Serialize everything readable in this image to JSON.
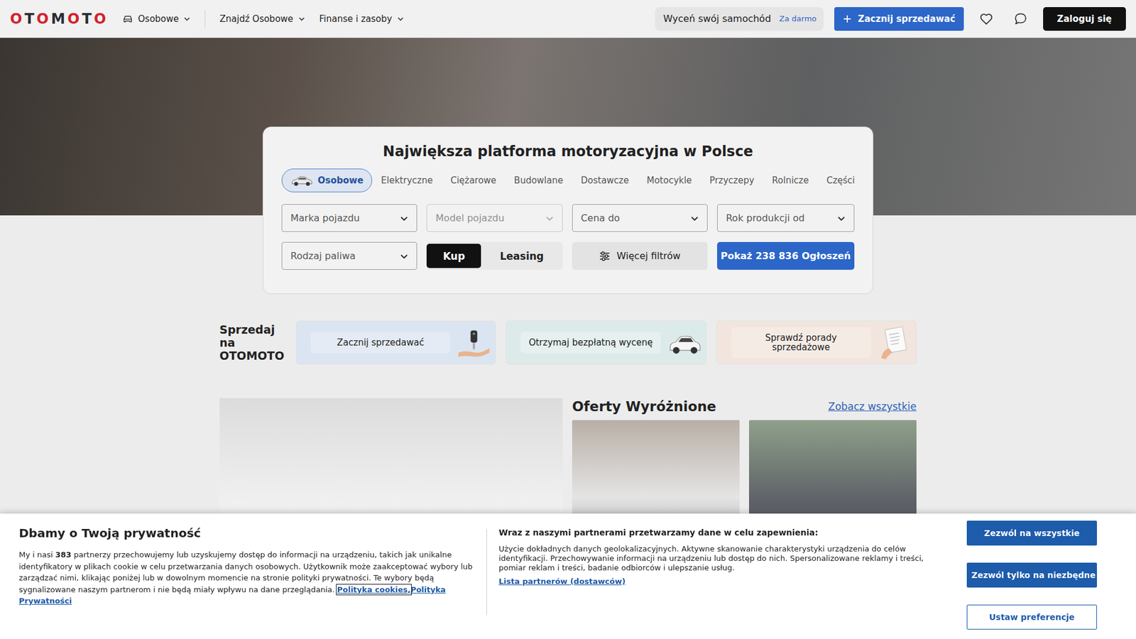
{
  "header": {
    "logo": "OTOMOTO",
    "nav": [
      {
        "label": "Osobowe"
      },
      {
        "label": "Znajdź Osobowe"
      },
      {
        "label": "Finanse i zasoby"
      }
    ],
    "valuation": {
      "label": "Wyceń swój samochód",
      "badge": "Za darmo"
    },
    "sell_button": "Zacznij sprzedawać",
    "login_button": "Zaloguj się"
  },
  "search": {
    "title": "Największa platforma motoryzacyjna w Polsce",
    "tabs": [
      {
        "label": "Osobowe",
        "selected": true
      },
      {
        "label": "Elektryczne",
        "selected": false
      },
      {
        "label": "Ciężarowe",
        "selected": false
      },
      {
        "label": "Budowlane",
        "selected": false
      },
      {
        "label": "Dostawcze",
        "selected": false
      },
      {
        "label": "Motocykle",
        "selected": false
      },
      {
        "label": "Przyczepy",
        "selected": false
      },
      {
        "label": "Rolnicze",
        "selected": false
      },
      {
        "label": "Części",
        "selected": false
      }
    ],
    "filters": [
      {
        "placeholder": "Marka pojazdu",
        "disabled": false
      },
      {
        "placeholder": "Model pojazdu",
        "disabled": true
      },
      {
        "placeholder": "Cena do",
        "disabled": false
      },
      {
        "placeholder": "Rok produkcji od",
        "disabled": false
      },
      {
        "placeholder": "Rodzaj paliwa",
        "disabled": false
      }
    ],
    "mode": [
      {
        "label": "Kup",
        "selected": true
      },
      {
        "label": "Leasing",
        "selected": false
      }
    ],
    "more_filters": "Więcej filtrów",
    "submit": "Pokaż 238 836 Ogłoszeń"
  },
  "sell": {
    "title": "Sprzedaj na OTOMOTO",
    "cards": [
      {
        "label": "Zacznij sprzedawać",
        "color": "#dbe5f1"
      },
      {
        "label": "Otrzymaj bezpłatną wycenę",
        "color": "#dcebea"
      },
      {
        "label": "Sprawdź porady sprzedażowe",
        "color": "#f2e5dd"
      }
    ]
  },
  "featured": {
    "title": "Oferty Wyróżnione",
    "link": "Zobacz wszystkie"
  },
  "cookies": {
    "title": "Dbamy o Twoją prywatność",
    "text_before": "My i nasi ",
    "partner_count": "383",
    "text_after": " partnerzy przechowujemy lub uzyskujemy dostęp do informacji na urządzeniu, takich jak unikalne identyfikatory w plikach cookie w celu przetwarzania danych osobowych. Użytkownik może zaakceptować wybory lub zarządzać nimi, klikając poniżej lub w dowolnym momencie na stronie polityki prywatności. Te wybory będą sygnalizowane naszym partnerom i nie będą miały wpływu na dane przeglądania.",
    "links": [
      "Polityka cookies,",
      "Polityka Prywatności"
    ],
    "purposes_title": "Wraz z naszymi partnerami przetwarzamy dane w celu zapewnienia:",
    "purposes": "Użycie dokładnych danych geolokalizacyjnych. Aktywne skanowanie charakterystyki urządzenia do celów identyfikacji. Przechowywanie informacji na urządzeniu lub dostęp do nich. Spersonalizowane reklamy i treści, pomiar reklam i treści, badanie odbiorców i ulepszanie usług.",
    "partners_link": "Lista partnerów (dostawców)",
    "buttons": [
      {
        "label": "Zezwól na wszystkie",
        "kind": "primary"
      },
      {
        "label": "Zezwól tylko na niezbędne",
        "kind": "primary"
      },
      {
        "label": "Ustaw preferencje",
        "kind": "outline"
      }
    ]
  }
}
